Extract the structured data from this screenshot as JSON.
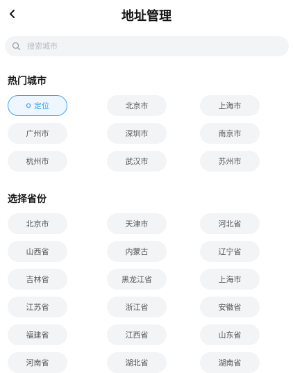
{
  "header": {
    "title": "地址管理"
  },
  "search": {
    "placeholder": "搜索城市"
  },
  "hot": {
    "title": "热门城市",
    "locate_label": "定位",
    "cities": [
      "北京市",
      "上海市",
      "广州市",
      "深圳市",
      "南京市",
      "杭州市",
      "武汉市",
      "苏州市"
    ]
  },
  "provinces": {
    "title": "选择省份",
    "items": [
      "北京市",
      "天津市",
      "河北省",
      "山西省",
      "内蒙古",
      "辽宁省",
      "吉林省",
      "黑龙江省",
      "上海市",
      "江苏省",
      "浙江省",
      "安徽省",
      "福建省",
      "江西省",
      "山东省",
      "河南省",
      "湖北省",
      "湖南省"
    ]
  },
  "colors": {
    "accent": "#3aa3ff",
    "chip_bg": "#f3f4f6"
  }
}
